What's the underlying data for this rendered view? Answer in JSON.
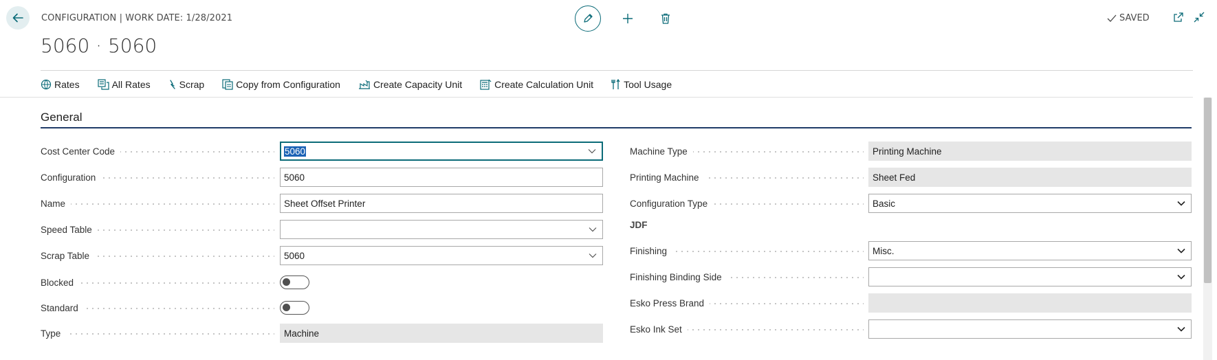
{
  "header": {
    "breadcrumb": "CONFIGURATION | WORK DATE: 1/28/2021",
    "title": "5060 · 5060",
    "status": "SAVED"
  },
  "toolbar": {
    "rates": "Rates",
    "all_rates": "All Rates",
    "scrap": "Scrap",
    "copy_from_configuration": "Copy from Configuration",
    "create_capacity_unit": "Create Capacity Unit",
    "create_calculation_unit": "Create Calculation Unit",
    "tool_usage": "Tool Usage"
  },
  "section": {
    "title": "General"
  },
  "left_fields": {
    "cost_center_code": {
      "label": "Cost Center Code",
      "value": "5060"
    },
    "configuration": {
      "label": "Configuration",
      "value": "5060"
    },
    "name": {
      "label": "Name",
      "value": "Sheet Offset Printer"
    },
    "speed_table": {
      "label": "Speed Table",
      "value": ""
    },
    "scrap_table": {
      "label": "Scrap Table",
      "value": "5060"
    },
    "blocked": {
      "label": "Blocked",
      "value": "off"
    },
    "standard": {
      "label": "Standard",
      "value": "off"
    },
    "type": {
      "label": "Type",
      "value": "Machine"
    }
  },
  "right_fields": {
    "machine_type": {
      "label": "Machine Type",
      "value": "Printing Machine"
    },
    "printing_machine": {
      "label": "Printing Machine",
      "value": "Sheet Fed"
    },
    "configuration_type": {
      "label": "Configuration Type",
      "value": "Basic"
    },
    "jdf_heading": "JDF",
    "finishing": {
      "label": "Finishing",
      "value": "Misc."
    },
    "finishing_binding_side": {
      "label": "Finishing Binding Side",
      "value": ""
    },
    "esko_press_brand": {
      "label": "Esko Press Brand",
      "value": ""
    },
    "esko_ink_set": {
      "label": "Esko Ink Set",
      "value": ""
    }
  },
  "colors": {
    "accent": "#0b6b78",
    "section_rule": "#1f3b68",
    "selection": "#1b62b5"
  }
}
